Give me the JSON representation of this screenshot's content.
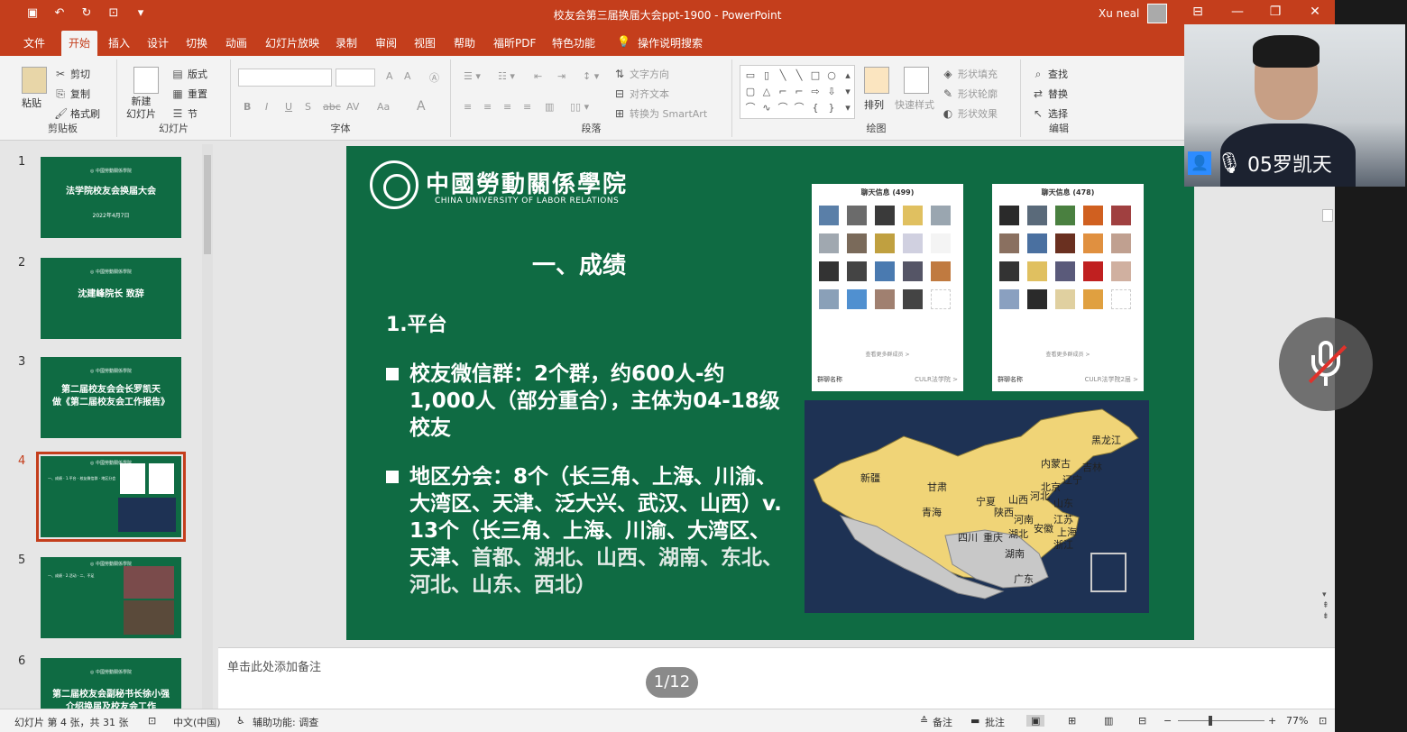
{
  "window": {
    "title": "校友会第三届换届大会ppt-1900  -  PowerPoint",
    "user": "Xu neal"
  },
  "menu": [
    "文件",
    "开始",
    "插入",
    "设计",
    "切换",
    "动画",
    "幻灯片放映",
    "录制",
    "审阅",
    "视图",
    "帮助",
    "福昕PDF",
    "特色功能",
    "操作说明搜索"
  ],
  "ribbon": {
    "clipboard": {
      "paste": "粘贴",
      "cut": "剪切",
      "copy": "复制",
      "format_painter": "格式刷",
      "label": "剪贴板"
    },
    "slides": {
      "new_slide": "新建\n幻灯片",
      "layout": "版式",
      "reset": "重置",
      "section": "节",
      "label": "幻灯片"
    },
    "font": {
      "label": "字体",
      "bold": "B",
      "italic": "I",
      "underline": "U",
      "shadow": "S",
      "strike": "abc",
      "spacing": "AV",
      "case": "Aa",
      "color": "A"
    },
    "paragraph": {
      "text_direction": "文字方向",
      "align_text": "对齐文本",
      "smartart": "转换为 SmartArt",
      "label": "段落"
    },
    "drawing": {
      "arrange": "排列",
      "quick_styles": "快速样式",
      "shape_fill": "形状填充",
      "shape_outline": "形状轮廓",
      "shape_effects": "形状效果",
      "label": "绘图"
    },
    "editing": {
      "find": "查找",
      "replace": "替换",
      "select": "选择",
      "label": "编辑"
    }
  },
  "thumbnails": [
    {
      "num": "1",
      "title": "法学院校友会换届大会",
      "date": "2022年4月7日"
    },
    {
      "num": "2",
      "title": "沈建峰院长  致辞"
    },
    {
      "num": "3",
      "title": "第二届校友会会长罗凯天\n做《第二届校友会工作报告》"
    },
    {
      "num": "4",
      "title": ""
    },
    {
      "num": "5",
      "title": ""
    },
    {
      "num": "6",
      "title": "第二届校友会副秘书长徐小强\n介绍换届及校友会工作"
    }
  ],
  "slide": {
    "uni_cn": "中國勞動關係學院",
    "uni_en": "CHINA UNIVERSITY OF LABOR RELATIONS",
    "heading": "一、成绩",
    "sub": "1.平台",
    "bullet1": "校友微信群：2个群，约600人-约1,000人（部分重合），主体为04-18级校友",
    "bullet2a": "地区分会：8个（长三角、上海、川渝、大湾区、天津、泛大兴、武汉、山西）",
    "bullet2b": "v. 13个（长三角、上海、川渝、大湾区、天津、",
    "bullet2c": "首都、湖北、山西、湖南、东北、河北、山东、西北）",
    "phone1": {
      "title": "聊天信息 (499)",
      "more": "查看更多群成员 >",
      "gname": "群聊名称",
      "gval": "CULR法学院 >"
    },
    "phone2": {
      "title": "聊天信息 (478)",
      "more": "查看更多群成员 >",
      "gname": "群聊名称",
      "gval": "CULR法学院2届 >"
    },
    "map_labels": [
      "黑龙江",
      "吉林",
      "内蒙古",
      "辽宁",
      "北京",
      "河北",
      "新疆",
      "甘肃",
      "宁夏",
      "山西",
      "山东",
      "青海",
      "陕西",
      "河南",
      "江苏",
      "上海",
      "安徽",
      "湖北",
      "四川",
      "重庆",
      "浙江",
      "湖南",
      "广东"
    ]
  },
  "notes_placeholder": "单击此处添加备注",
  "page_indicator": "1/12",
  "status": {
    "slide_info": "幻灯片 第 4 张，共 31 张",
    "language": "中文(中国)",
    "accessibility": "辅助功能: 调查",
    "notes": "备注",
    "comments": "批注",
    "zoom": "77%"
  },
  "video": {
    "name": "05罗凯天"
  },
  "colors": {
    "accent": "#c43e1c",
    "slide_bg": "#0f6b43",
    "map_bg": "#1e3254",
    "map_yellow": "#f0d477"
  }
}
